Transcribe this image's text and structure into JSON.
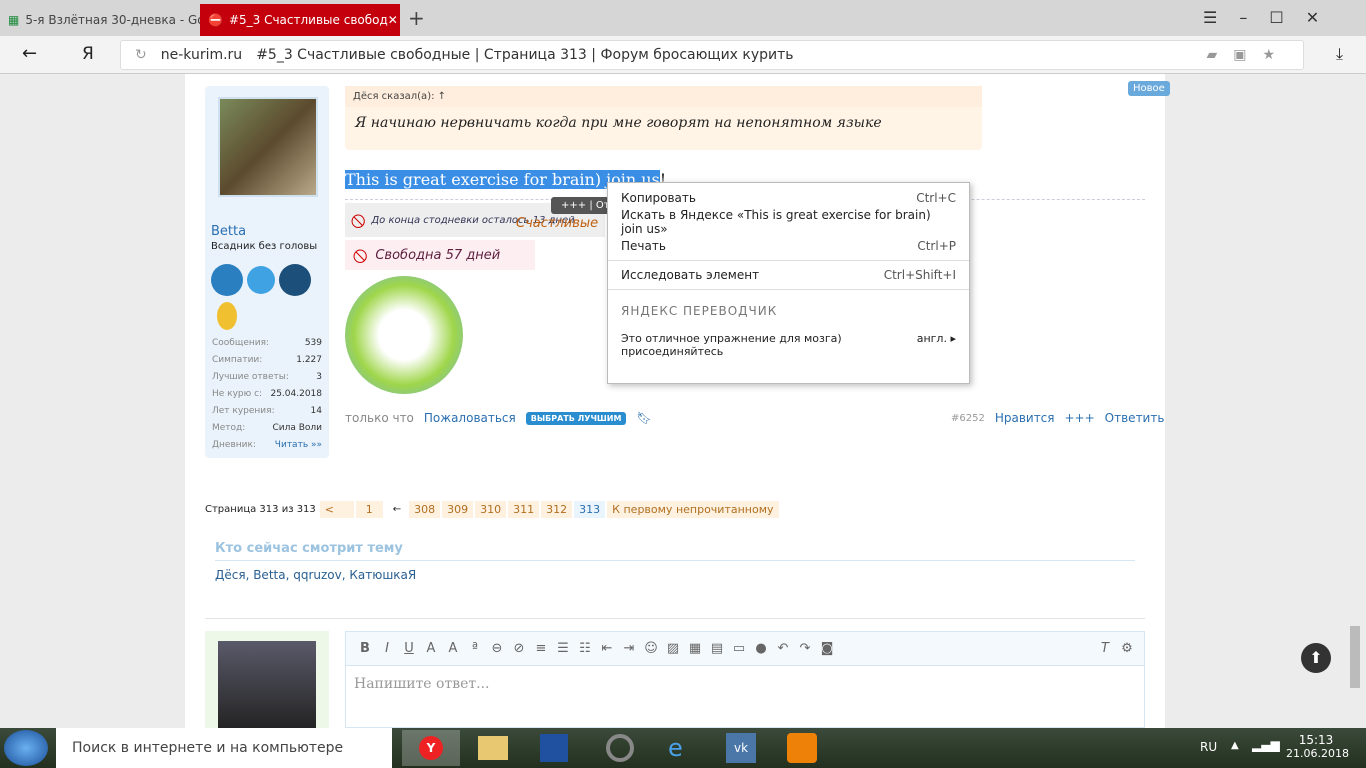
{
  "browser": {
    "tabs": [
      {
        "label": "5-я Взлётная 30-дневка - Go",
        "icon": "sheets-icon"
      },
      {
        "label": "#5_3 Счастливые свобод",
        "icon": "site-icon",
        "active": true
      }
    ],
    "new_tab": "+",
    "yandex": "Я",
    "domain": "ne-kurim.ru",
    "page_title": "#5_3 Счастливые свободные | Страница 313 | Форум бросающих курить"
  },
  "badge_new": "Новое",
  "user": {
    "name": "Betta",
    "title": "Всадник без головы",
    "stats": [
      [
        "Сообщения:",
        "539"
      ],
      [
        "Симпатии:",
        "1.227"
      ],
      [
        "Лучшие ответы:",
        "3"
      ],
      [
        "Не курю с:",
        "25.04.2018"
      ],
      [
        "Лет курения:",
        "14"
      ],
      [
        "Метод:",
        "Сила Воли"
      ],
      [
        "Дневник:",
        "Читать »»"
      ]
    ]
  },
  "post": {
    "quote_author": "Дёся сказал(а): ↑",
    "quote_text": "Я начинаю нервничать когда при мне говорят на непонятном языке",
    "text_selected": "This is great exercise for brain) join us",
    "text_rest": "!",
    "sig1": "До конца стодневки осталось 13 дней",
    "sig1_overlay": "Счастливые",
    "popup": "+++ | Отв",
    "sig2": "Свободна 57 дней",
    "time": "только что",
    "report": "Пожаловаться",
    "best": "ВЫБРАТЬ ЛУЧШИМ",
    "num": "#6252",
    "like": "Нравится",
    "plus": "+++",
    "reply": "Ответить"
  },
  "context_menu": {
    "items": [
      [
        "Копировать",
        "Ctrl+C"
      ],
      [
        "Искать в Яндексе «This is great exercise for brain) join us»",
        ""
      ],
      [
        "Печать",
        "Ctrl+P"
      ],
      [
        "Исследовать элемент",
        "Ctrl+Shift+I"
      ]
    ],
    "section": "ЯНДЕКС ПЕРЕВОДЧИК",
    "translation": "Это отличное упражнение для мозга) присоединяйтесь",
    "lang": "англ."
  },
  "pagination": {
    "label": "Страница 313 из 313",
    "prev": "<",
    "first": "1",
    "sep": "←",
    "pages": [
      "308",
      "309",
      "310",
      "311",
      "312",
      "313"
    ],
    "current": "313",
    "unread": "К первому непрочитанному"
  },
  "viewers": {
    "title": "Кто сейчас смотрит тему",
    "names": "Дёся, Betta, qqruzov, КатюшкаЯ"
  },
  "editor": {
    "placeholder": "Напишите ответ..."
  },
  "taskbar": {
    "search": "Поиск в интернете и на компьютере",
    "lang": "RU",
    "time": "15:13",
    "date": "21.06.2018"
  }
}
